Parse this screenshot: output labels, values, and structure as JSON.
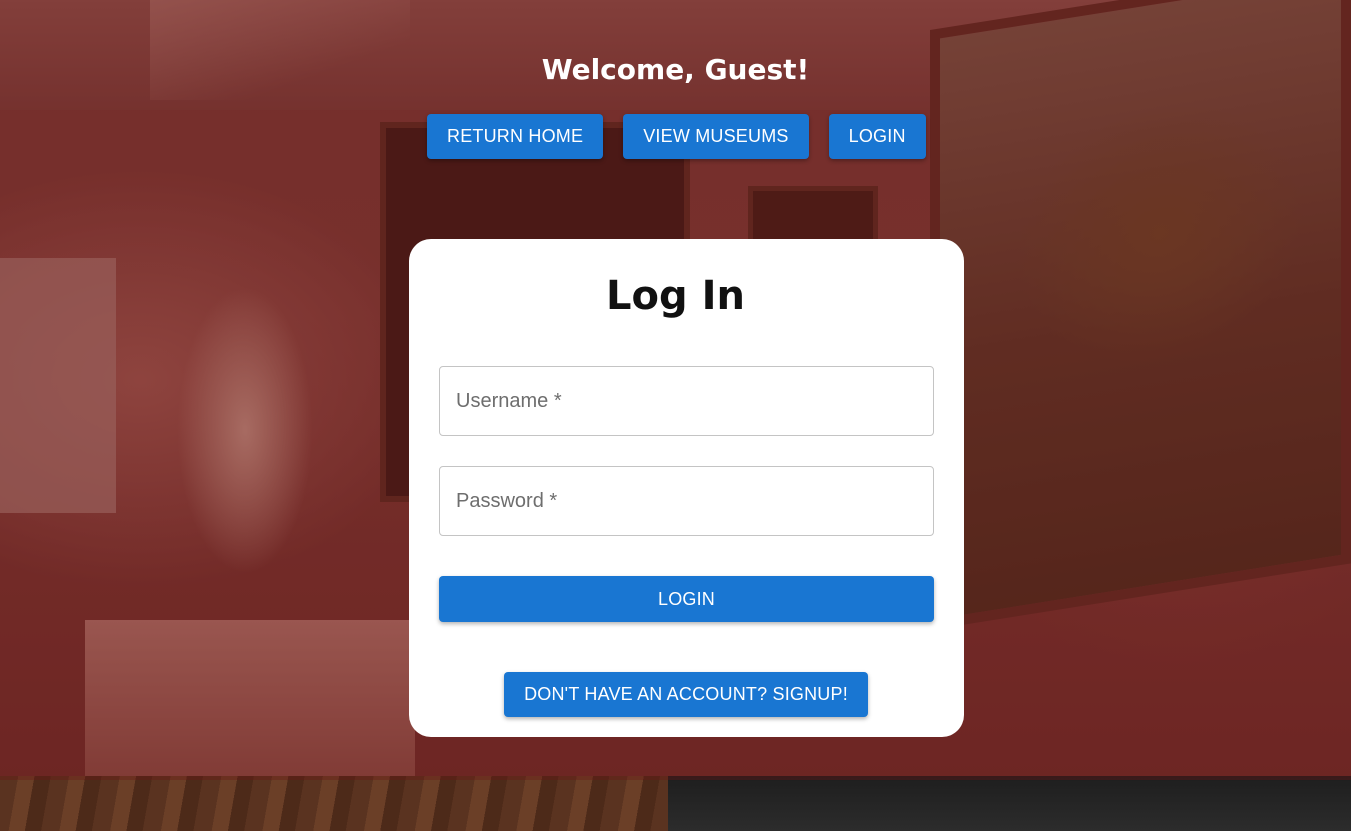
{
  "header": {
    "welcome_text": "Welcome, Guest!"
  },
  "nav": {
    "items": [
      {
        "label": "RETURN HOME"
      },
      {
        "label": "VIEW MUSEUMS"
      },
      {
        "label": "LOGIN"
      }
    ]
  },
  "login_form": {
    "title": "Log In",
    "username_placeholder": "Username *",
    "password_placeholder": "Password *",
    "username_value": "",
    "password_value": "",
    "submit_label": "LOGIN",
    "signup_label": "DON'T HAVE AN ACCOUNT? SIGNUP!"
  },
  "colors": {
    "accent": "#1976d2",
    "overlay": "#6e1414",
    "card_bg": "#ffffff"
  }
}
